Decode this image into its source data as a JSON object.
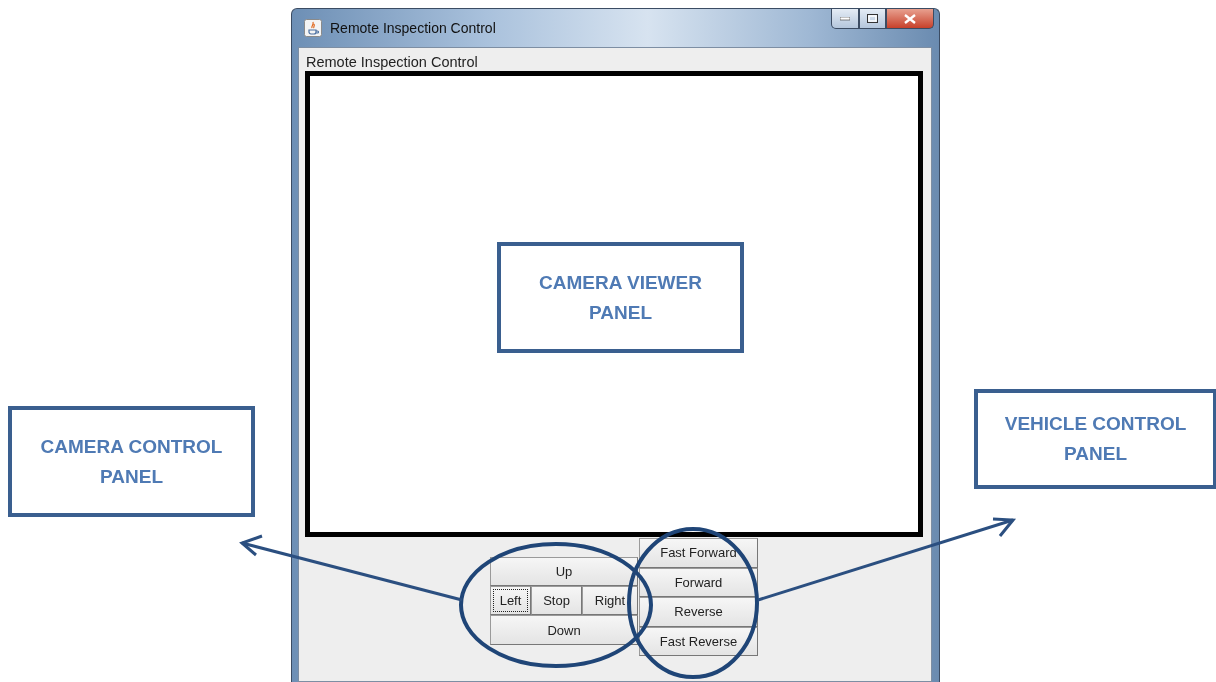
{
  "window": {
    "title": "Remote Inspection Control"
  },
  "panel_label": "Remote Inspection Control",
  "camera_buttons": [
    {
      "label": "Up",
      "focused": false
    },
    {
      "label": "Left",
      "focused": true
    },
    {
      "label": "Stop",
      "focused": false
    },
    {
      "label": "Right",
      "focused": false
    },
    {
      "label": "Down",
      "focused": false
    }
  ],
  "vehicle_buttons": [
    {
      "label": "Fast Forward",
      "focused": false
    },
    {
      "label": "Forward",
      "focused": false
    },
    {
      "label": "Reverse",
      "focused": false
    },
    {
      "label": "Fast Reverse",
      "focused": false
    }
  ],
  "callouts": [
    {
      "kind": "viewer",
      "lines": [
        "CAMERA VIEWER",
        "PANEL"
      ]
    },
    {
      "kind": "camera",
      "lines": [
        "CAMERA CONTROL",
        "PANEL"
      ]
    },
    {
      "kind": "vehicle",
      "lines": [
        "VEHICLE CONTROL",
        "PANEL"
      ]
    }
  ]
}
